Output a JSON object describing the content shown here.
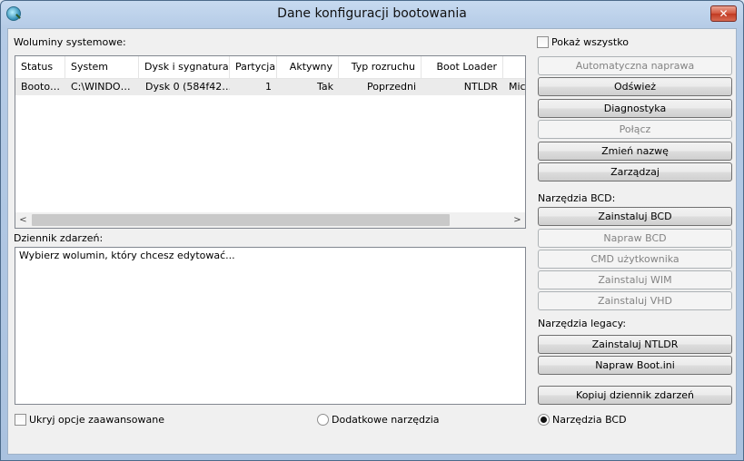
{
  "window": {
    "title": "Dane konfiguracji bootowania",
    "close_glyph": "✕"
  },
  "volumes": {
    "label": "Woluminy systemowe:",
    "columns": [
      "Status",
      "System",
      "Dysk i sygnatura",
      "Partycja",
      "Aktywny",
      "Typ rozruchu",
      "Boot Loader"
    ],
    "rows": [
      [
        "Booto…",
        "C:\\WINDO…",
        "Dysk 0 (584f42…",
        "1",
        "Tak",
        "Poprzedni",
        "NTLDR",
        "Mic"
      ]
    ],
    "scroll_left": "<",
    "scroll_right": ">"
  },
  "log": {
    "label": "Dziennik zdarzeń:",
    "text": "Wybierz wolumin, który chcesz edytować..."
  },
  "show_all": {
    "label": "Pokaż wszystko",
    "checked": false
  },
  "buttons": {
    "auto_repair": "Automatyczna naprawa",
    "refresh": "Odśwież",
    "diagnostics": "Diagnostyka",
    "connect": "Połącz",
    "rename": "Zmień nazwę",
    "manage": "Zarządzaj"
  },
  "bcd_tools": {
    "label": "Narzędzia BCD:",
    "install": "Zainstaluj BCD",
    "repair": "Napraw BCD",
    "cmd": "CMD użytkownika",
    "install_wim": "Zainstaluj WIM",
    "install_vhd": "Zainstaluj VHD"
  },
  "legacy_tools": {
    "label": "Narzędzia legacy:",
    "install_ntldr": "Zainstaluj NTLDR",
    "repair_bootini": "Napraw Boot.ini"
  },
  "copy_log": "Kopiuj dziennik zdarzeń",
  "bottom": {
    "hide_advanced": "Ukryj opcje zaawansowane",
    "extra_tools": "Dodatkowe narzędzia",
    "bcd_tools": "Narzędzia BCD",
    "selected": "bcd_tools"
  }
}
